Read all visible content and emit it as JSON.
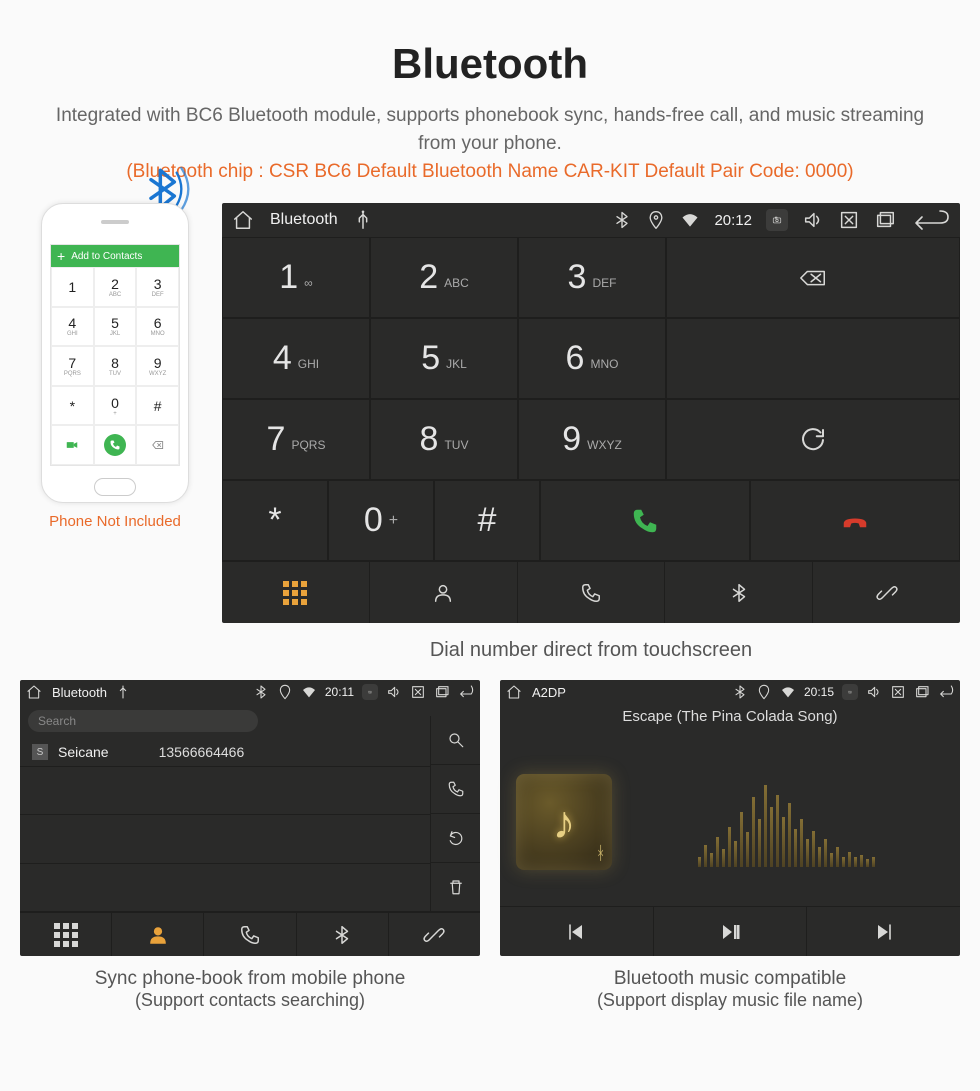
{
  "hero": {
    "title": "Bluetooth",
    "subtitle": "Integrated with BC6 Bluetooth module, supports phonebook sync, hands-free call, and music streaming from your phone.",
    "specs": "(Bluetooth chip : CSR BC6    Default Bluetooth Name CAR-KIT    Default Pair Code: 0000)"
  },
  "phone": {
    "appbar_label": "Add to Contacts",
    "note": "Phone Not Included",
    "keys": [
      "1",
      "2",
      "3",
      "4",
      "5",
      "6",
      "7",
      "8",
      "9",
      "*",
      "0",
      "#"
    ],
    "letters": [
      "",
      "ABC",
      "DEF",
      "GHI",
      "JKL",
      "MNO",
      "PQRS",
      "TUV",
      "WXYZ",
      "",
      "+",
      ""
    ]
  },
  "dialer": {
    "status": {
      "title": "Bluetooth",
      "time": "20:12"
    },
    "keys": [
      {
        "d": "1",
        "l": "∞"
      },
      {
        "d": "2",
        "l": "ABC"
      },
      {
        "d": "3",
        "l": "DEF"
      },
      {
        "d": "4",
        "l": "GHI"
      },
      {
        "d": "5",
        "l": "JKL"
      },
      {
        "d": "6",
        "l": "MNO"
      },
      {
        "d": "7",
        "l": "PQRS"
      },
      {
        "d": "8",
        "l": "TUV"
      },
      {
        "d": "9",
        "l": "WXYZ"
      },
      {
        "d": "*",
        "l": ""
      },
      {
        "d": "0",
        "l": "+"
      },
      {
        "d": "#",
        "l": ""
      }
    ],
    "caption": "Dial number direct from touchscreen"
  },
  "contacts": {
    "status": {
      "title": "Bluetooth",
      "time": "20:11"
    },
    "search_placeholder": "Search",
    "entries": [
      {
        "initial": "S",
        "name": "Seicane",
        "number": "13566664466"
      }
    ],
    "caption": "Sync phone-book from mobile phone",
    "sub": "(Support contacts searching)"
  },
  "music": {
    "status": {
      "title": "A2DP",
      "time": "20:15"
    },
    "track": "Escape (The Pina Colada Song)",
    "eq": [
      10,
      22,
      14,
      30,
      18,
      40,
      26,
      55,
      35,
      70,
      48,
      82,
      60,
      72,
      50,
      64,
      38,
      48,
      28,
      36,
      20,
      28,
      14,
      20,
      10,
      15,
      10,
      12,
      8,
      10
    ],
    "caption": "Bluetooth music compatible",
    "sub": "(Support display music file name)"
  }
}
